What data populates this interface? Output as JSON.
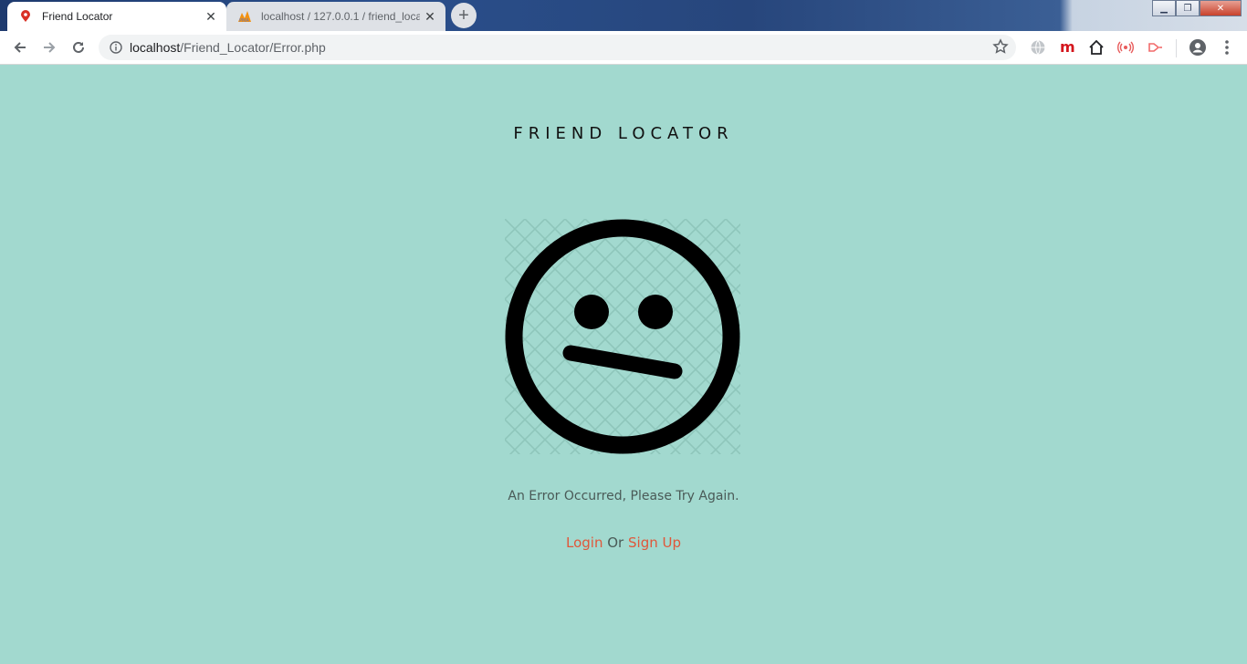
{
  "browser": {
    "tabs": [
      {
        "title": "Friend Locator",
        "active": true,
        "icon": "location-pin-icon"
      },
      {
        "title": "localhost / 127.0.0.1 / friend_loca",
        "active": false,
        "icon": "phpmyadmin-icon"
      }
    ],
    "new_tab_label": "+",
    "address": {
      "host": "localhost",
      "path": "/Friend_Locator/Error.php"
    }
  },
  "page": {
    "brand": "FRIEND LOCATOR",
    "error_message": "An Error Occurred, Please Try Again.",
    "login_label": "Login",
    "or_label": "Or",
    "signup_label": "Sign Up"
  },
  "colors": {
    "page_background": "#a2d9cf",
    "link": "#e0573a",
    "text": "#4a5a57"
  }
}
